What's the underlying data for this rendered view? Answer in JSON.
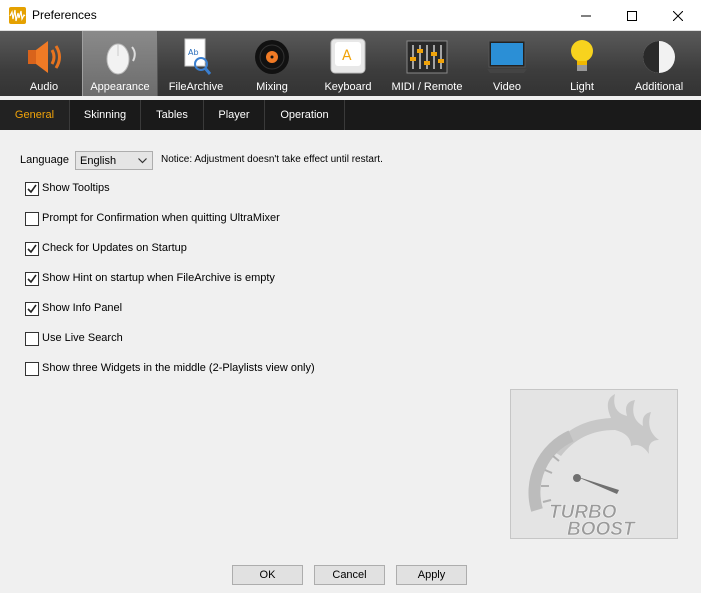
{
  "window": {
    "title": "Preferences",
    "controls": [
      "minimize",
      "maximize",
      "close"
    ]
  },
  "toolbar": {
    "items": [
      {
        "label": "Audio",
        "icon": "speaker-icon"
      },
      {
        "label": "Appearance",
        "icon": "mouse-icon",
        "active": true
      },
      {
        "label": "FileArchive",
        "icon": "file-search-icon"
      },
      {
        "label": "Mixing",
        "icon": "vinyl-record-icon"
      },
      {
        "label": "Keyboard",
        "icon": "keyboard-key-icon"
      },
      {
        "label": "MIDI / Remote",
        "icon": "mixer-faders-icon"
      },
      {
        "label": "Video",
        "icon": "monitor-icon"
      },
      {
        "label": "Light",
        "icon": "light-bulb-icon"
      },
      {
        "label": "Additional",
        "icon": "half-circle-icon"
      }
    ]
  },
  "tabs": [
    {
      "label": "General",
      "active": true
    },
    {
      "label": "Skinning"
    },
    {
      "label": "Tables"
    },
    {
      "label": "Player"
    },
    {
      "label": "Operation"
    }
  ],
  "language": {
    "label": "Language",
    "selected": "English",
    "notice": "Notice: Adjustment doesn't take effect until restart."
  },
  "options": [
    {
      "label": "Show Tooltips",
      "checked": true
    },
    {
      "label": "Prompt for Confirmation when quitting UltraMixer",
      "checked": false
    },
    {
      "label": "Check for Updates on Startup",
      "checked": true
    },
    {
      "label": "Show Hint on startup when FileArchive is empty",
      "checked": true
    },
    {
      "label": "Show Info Panel",
      "checked": true
    },
    {
      "label": "Use Live Search",
      "checked": false
    },
    {
      "label": "Show three Widgets in the middle (2-Playlists view only)",
      "checked": false
    }
  ],
  "turbo_boost": {
    "line1": "TURBO",
    "line2": "BOOST"
  },
  "buttons": {
    "ok": "OK",
    "cancel": "Cancel",
    "apply": "Apply"
  }
}
